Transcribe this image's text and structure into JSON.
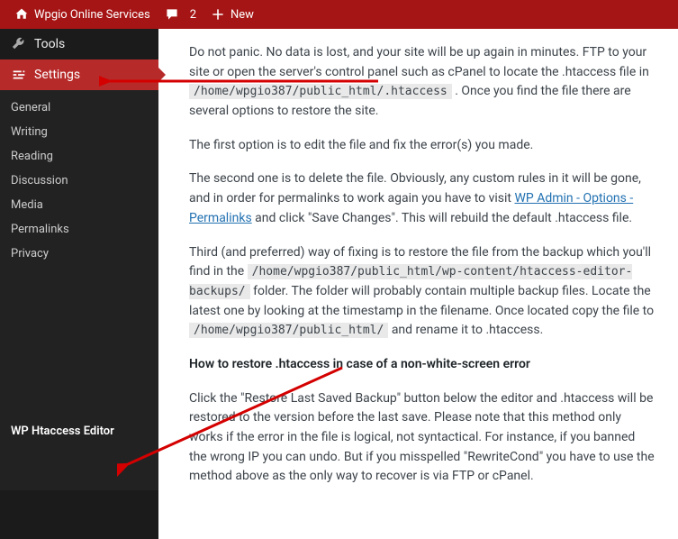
{
  "adminbar": {
    "site_name": "Wpgio Online Services",
    "comments_count": "2",
    "new_label": "New"
  },
  "sidebar": {
    "tools_label": "Tools",
    "settings_label": "Settings",
    "items": {
      "general": "General",
      "writing": "Writing",
      "reading": "Reading",
      "discussion": "Discussion",
      "media": "Media",
      "permalinks": "Permalinks",
      "privacy": "Privacy",
      "htaccess": "WP Htaccess Editor"
    }
  },
  "content": {
    "p1_a": "Do not panic. No data is lost, and your site will be up again in minutes. FTP to your site or open the server's control panel such as cPanel to locate the .htaccess file in ",
    "p1_code": "/home/wpgio387/public_html/.htaccess",
    "p1_b": ". Once you find the file there are several options to restore the site.",
    "p2": "The first option is to edit the file and fix the error(s) you made.",
    "p3_a": "The second one is to delete the file. Obviously, any custom rules in it will be gone, and in order for permalinks to work again you have to visit ",
    "p3_link": "WP Admin - Options - Permalinks",
    "p3_b": " and click \"Save Changes\". This will rebuild the default .htaccess file.",
    "p4_a": "Third (and preferred) way of fixing is to restore the file from the backup which you'll find in the ",
    "p4_code1": "/home/wpgio387/public_html/wp-content/htaccess-editor-backups/",
    "p4_b": " folder. The folder will probably contain multiple backup files. Locate the latest one by looking at the timestamp in the filename. Once located copy the file to ",
    "p4_code2": "/home/wpgio387/public_html/",
    "p4_c": " and rename it to .htaccess.",
    "p5": "How to restore .htaccess in case of a non-white-screen error",
    "p6": "Click the \"Restore Last Saved Backup\" button below the editor and .htaccess will be restored to the version before the last save. Please note that this method only works if the error in the file is logical, not syntactical. For instance, if you banned the wrong IP you can undo. But if you misspelled \"RewriteCond\" you have to use the method above as the only way to recover is via FTP or cPanel."
  }
}
